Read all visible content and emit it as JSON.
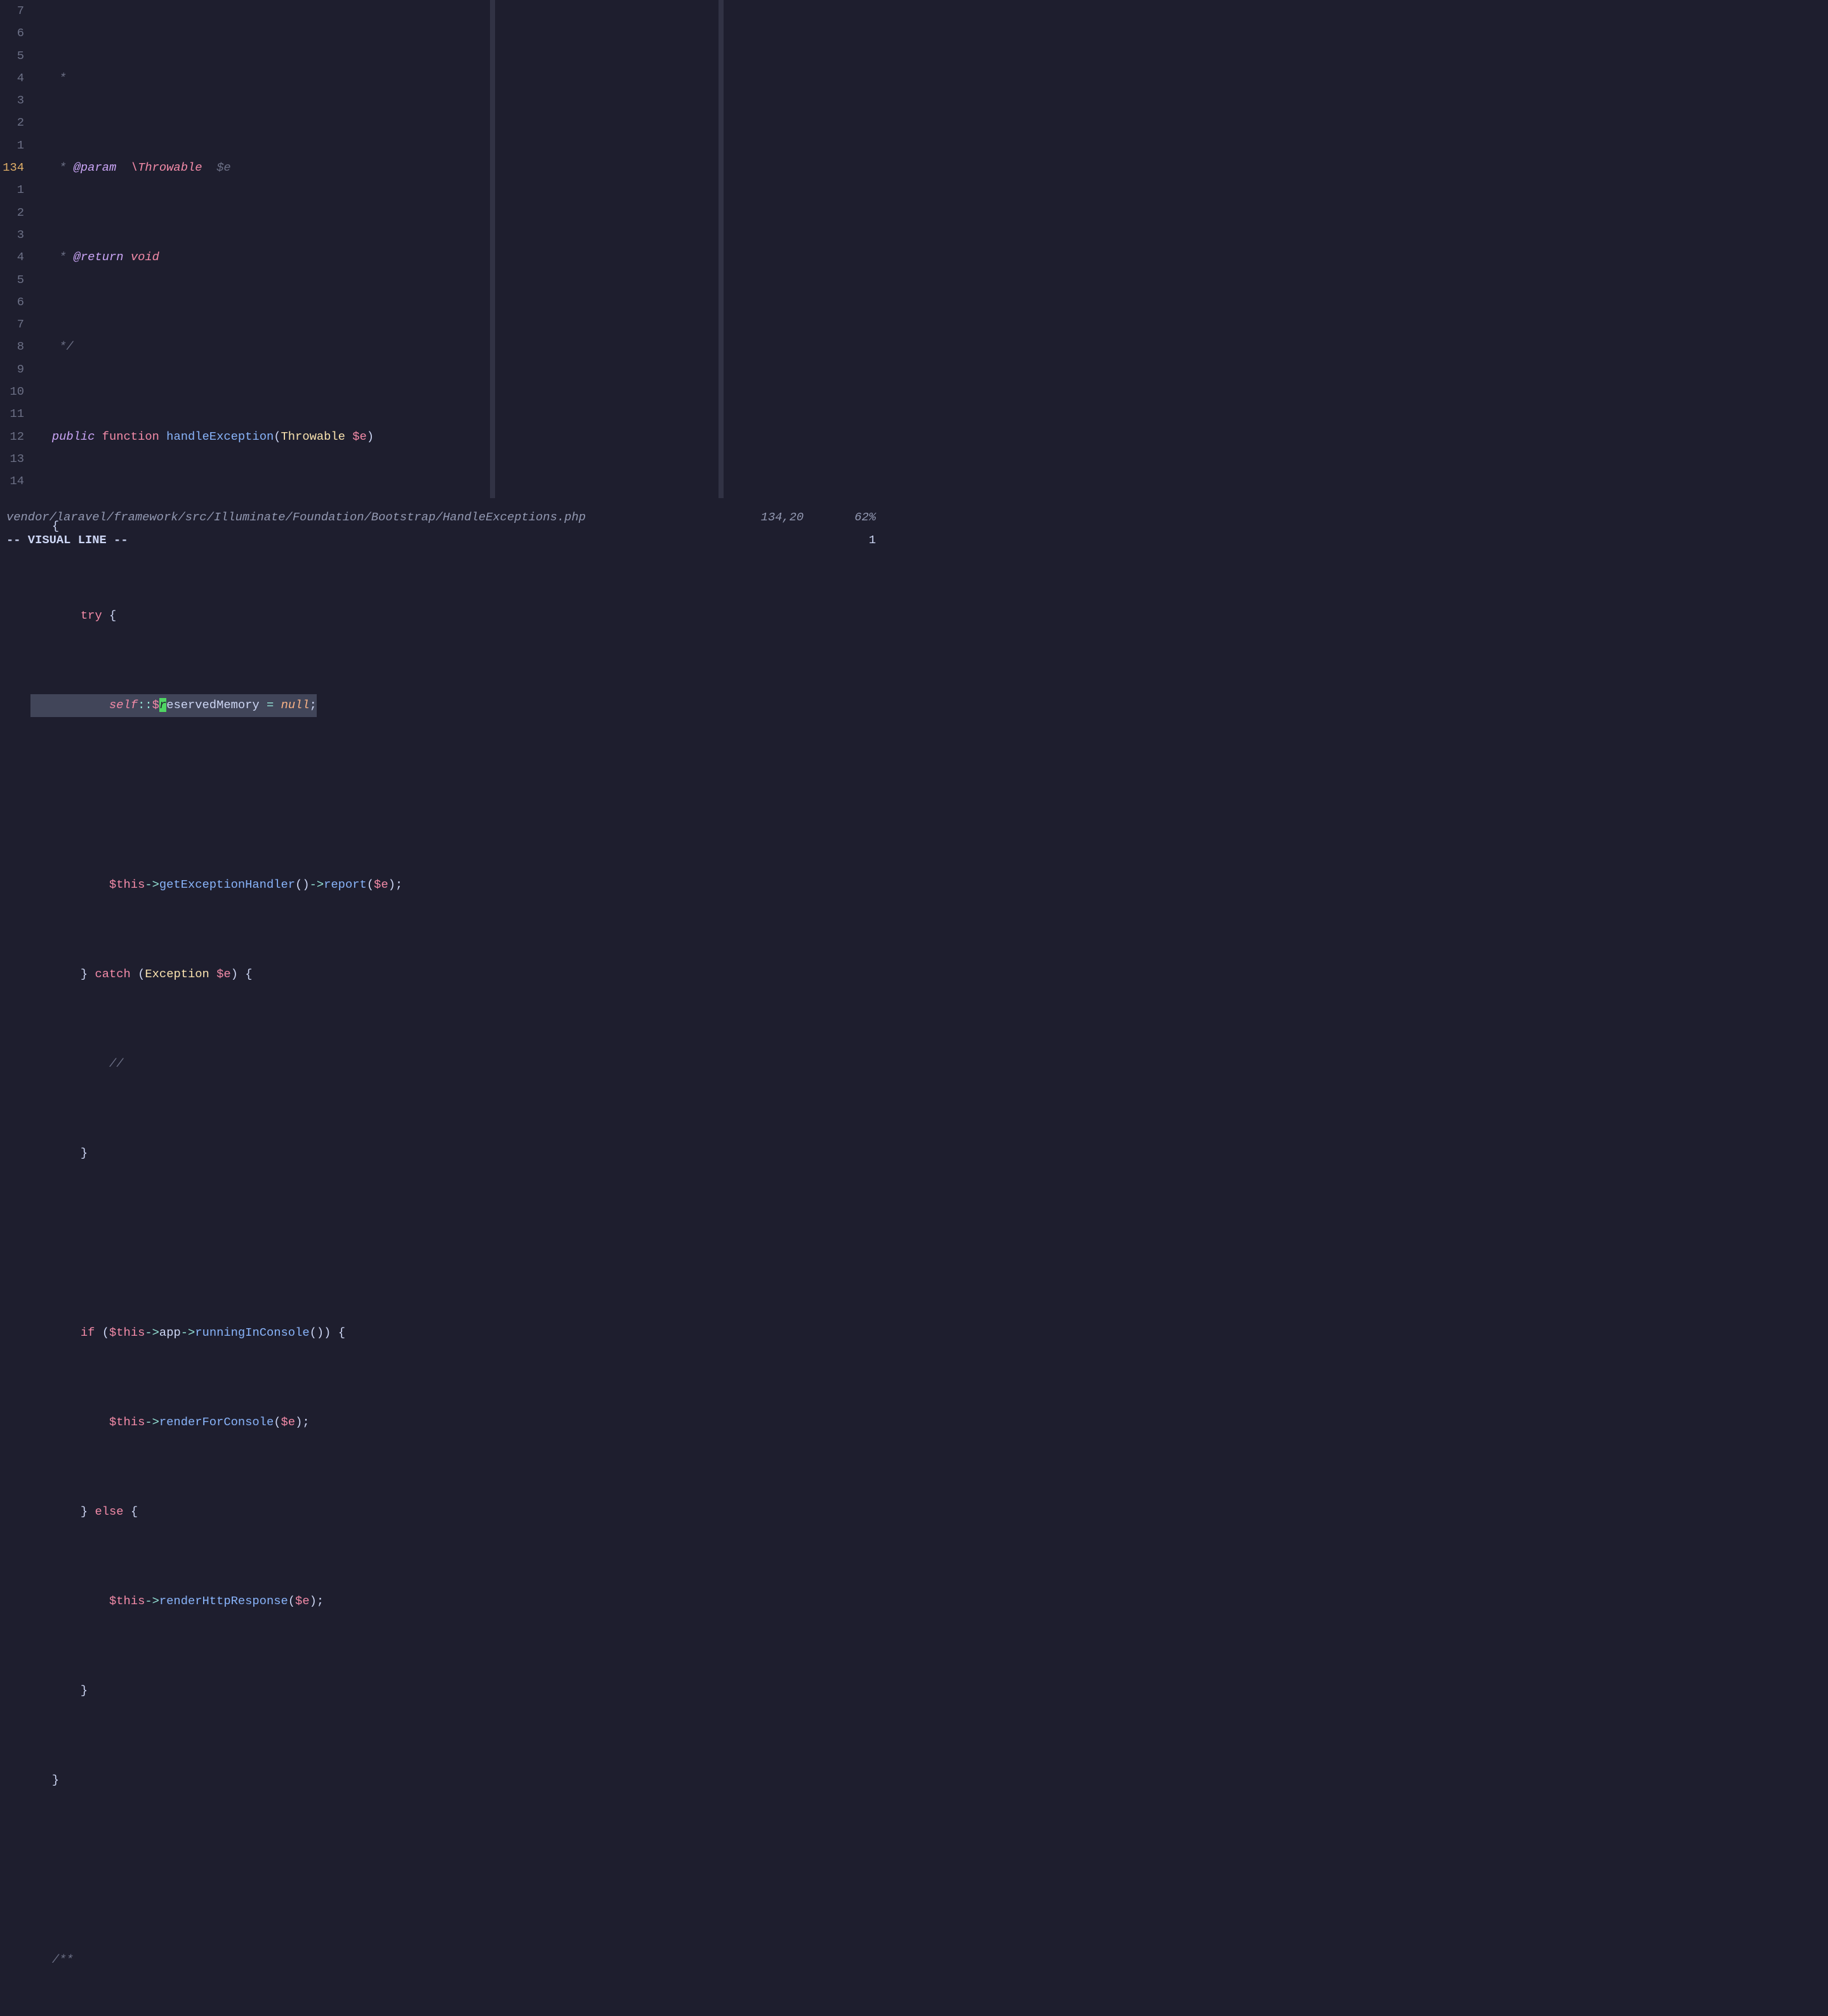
{
  "gutter": [
    "7",
    "6",
    "5",
    "4",
    "3",
    "2",
    "1",
    "134",
    "1",
    "2",
    "3",
    "4",
    "5",
    "6",
    "7",
    "8",
    "9",
    "10",
    "11",
    "12",
    "13",
    "14"
  ],
  "currentIndex": 7,
  "lines": {
    "l0": {
      "indent": "    ",
      "star": "*"
    },
    "l1": {
      "indent": "    ",
      "star": "* ",
      "tag": "@param",
      "sp": "  ",
      "type": "\\Throwable",
      "sp2": "  ",
      "var": "$e"
    },
    "l2": {
      "indent": "    ",
      "star": "* ",
      "tag": "@return",
      "sp": " ",
      "type": "void"
    },
    "l3": {
      "indent": "    ",
      "text": "*/"
    },
    "l4": {
      "indent": "   ",
      "kw1": "public",
      "sp": " ",
      "kw2": "function",
      "sp2": " ",
      "fn": "handleException",
      "open": "(",
      "type": "Throwable",
      "sp3": " ",
      "var": "$e",
      "close": ")"
    },
    "l5": {
      "indent": "   ",
      "text": "{"
    },
    "l6": {
      "indent": "       ",
      "kw": "try",
      "sp": " ",
      "brace": "{"
    },
    "l7": {
      "pre_indent": "",
      "vis_indent": "           ",
      "self": "self",
      "scope": "::",
      "dollar": "$",
      "cursor": "r",
      "rest": "eservedMemory",
      "sp": " ",
      "eq": "=",
      "sp2": " ",
      "null": "null",
      "semi": ";"
    },
    "l8": {
      "text": ""
    },
    "l9": {
      "indent": "           ",
      "var": "$this",
      "arrow": "->",
      "fn": "getExceptionHandler",
      "paren": "()",
      "arrow2": "->",
      "fn2": "report",
      "open": "(",
      "var2": "$e",
      "close": ")",
      ";": ";"
    },
    "l10": {
      "indent": "       ",
      "brace": "}",
      "sp": " ",
      "kw": "catch",
      "sp2": " ",
      "open": "(",
      "type": "Exception",
      "sp3": " ",
      "var": "$e",
      "close": ")",
      "sp4": " ",
      "brace2": "{"
    },
    "l11": {
      "indent": "           ",
      "text": "//"
    },
    "l12": {
      "indent": "       ",
      "text": "}"
    },
    "l13": {
      "text": ""
    },
    "l14": {
      "indent": "       ",
      "kw": "if",
      "sp": " ",
      "open": "(",
      "var": "$this",
      "arrow": "->",
      "prop": "app",
      "arrow2": "->",
      "fn": "runningInConsole",
      "paren": "()",
      ")": ")",
      "sp2": " ",
      "brace": "{"
    },
    "l15": {
      "indent": "           ",
      "var": "$this",
      "arrow": "->",
      "fn": "renderForConsole",
      "open": "(",
      "var2": "$e",
      "close": ")",
      ";": ";"
    },
    "l16": {
      "indent": "       ",
      "brace": "}",
      "sp": " ",
      "kw": "else",
      "sp2": " ",
      "brace2": "{"
    },
    "l17": {
      "indent": "           ",
      "var": "$this",
      "arrow": "->",
      "fn": "renderHttpResponse",
      "open": "(",
      "var2": "$e",
      "close": ")",
      ";": ";"
    },
    "l18": {
      "indent": "       ",
      "text": "}"
    },
    "l19": {
      "indent": "   ",
      "text": "}"
    },
    "l20": {
      "text": ""
    },
    "l21": {
      "indent": "   ",
      "text": "/**"
    }
  },
  "status": {
    "path": "vendor/laravel/framework/src/Illuminate/Foundation/Bootstrap/HandleExceptions.php",
    "pos": "134,20",
    "pct": "62%"
  },
  "cmd": {
    "mode": "-- VISUAL LINE --",
    "count": "1"
  }
}
